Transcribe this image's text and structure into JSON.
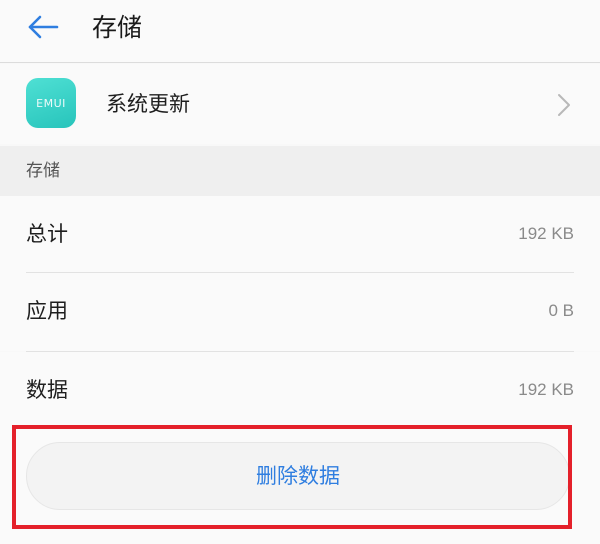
{
  "header": {
    "title": "存储",
    "back_icon": "arrow-left-icon"
  },
  "app": {
    "icon_text": "EMUI",
    "name": "系统更新",
    "chevron_icon": "chevron-right-icon"
  },
  "storage": {
    "section_label": "存储",
    "rows": [
      {
        "label": "总计",
        "value": "192 KB"
      },
      {
        "label": "应用",
        "value": "0 B"
      },
      {
        "label": "数据",
        "value": "192 KB"
      }
    ]
  },
  "actions": {
    "delete_label": "删除数据"
  },
  "colors": {
    "accent": "#2f7ee0",
    "icon_teal": "#27c4bb",
    "highlight": "#e4202a"
  }
}
